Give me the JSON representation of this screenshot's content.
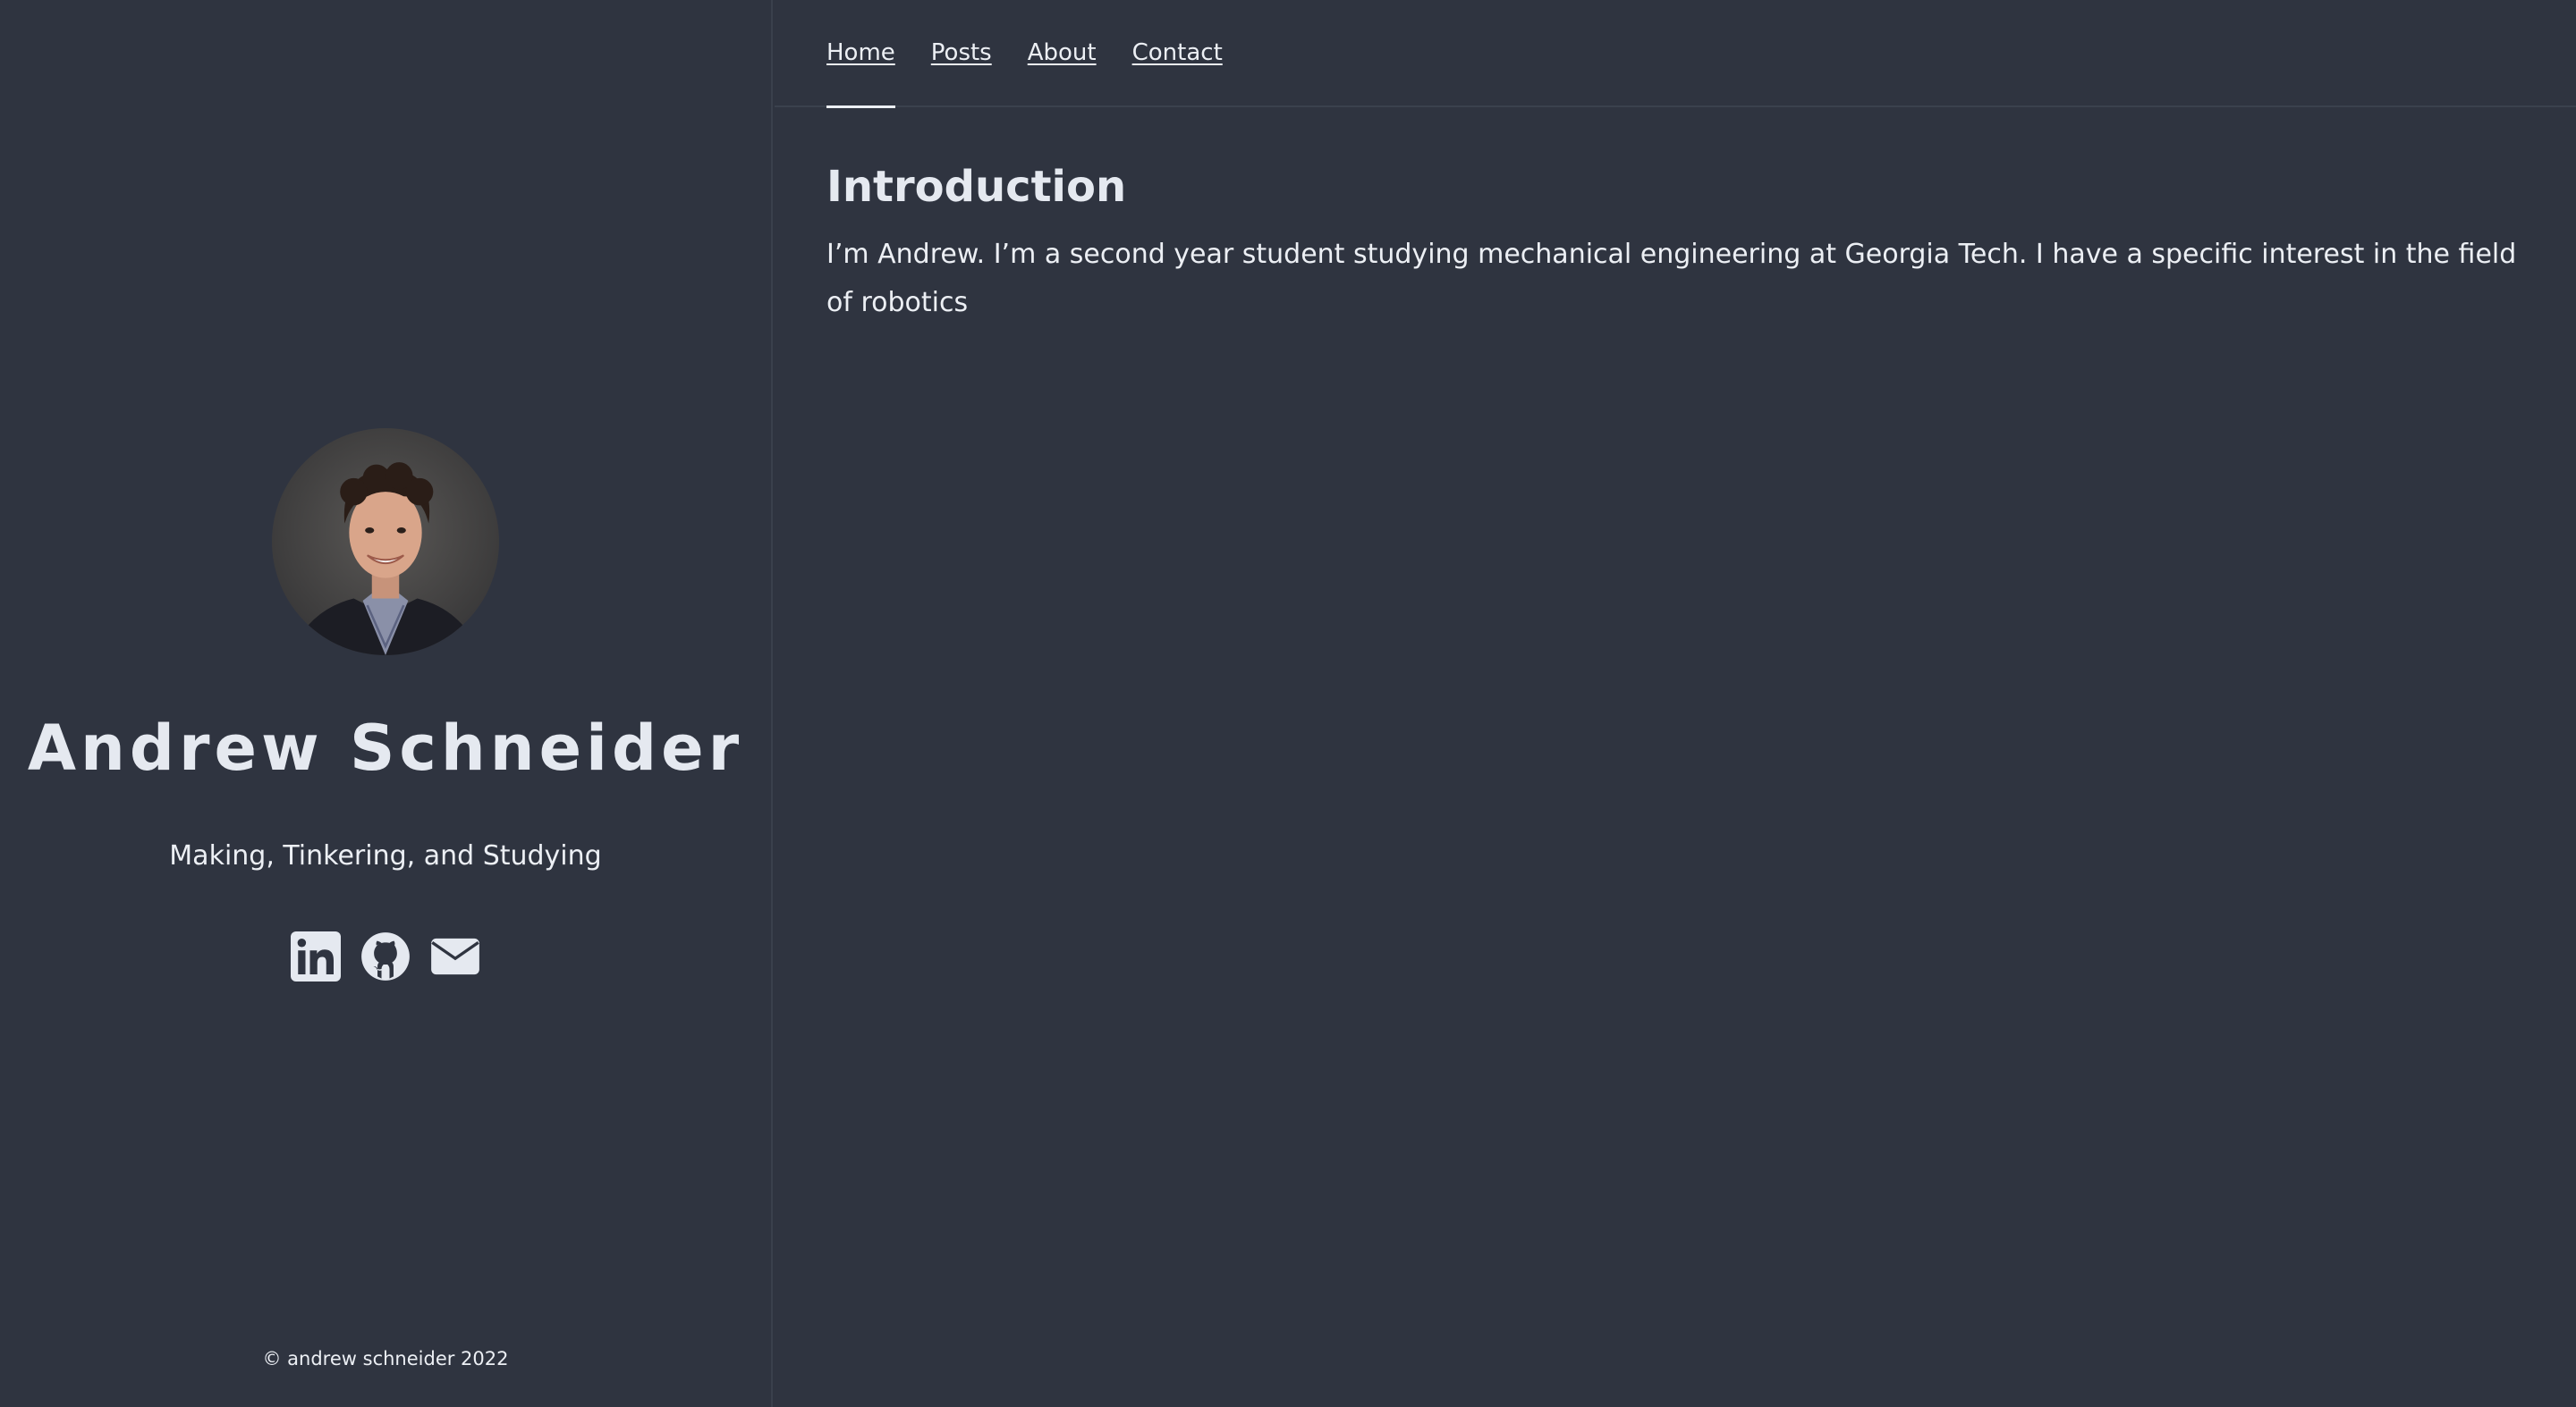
{
  "sidebar": {
    "title": "Andrew Schneider",
    "tagline": "Making, Tinkering, and Studying",
    "social": [
      {
        "name": "linkedin-icon",
        "label": "LinkedIn"
      },
      {
        "name": "github-icon",
        "label": "GitHub"
      },
      {
        "name": "mail-icon",
        "label": "Email"
      }
    ],
    "footer": "© andrew schneider 2022"
  },
  "nav": {
    "items": [
      "Home",
      "Posts",
      "About",
      "Contact"
    ],
    "active": "Home"
  },
  "main": {
    "heading": "Introduction",
    "paragraph": "I’m Andrew. I’m a second year student studying mechanical engineering at Georgia Tech. I have a specific interest in the field of robotics"
  },
  "colors": {
    "background": "#2f3440",
    "text": "#eceff4",
    "divider": "#3b414d"
  }
}
